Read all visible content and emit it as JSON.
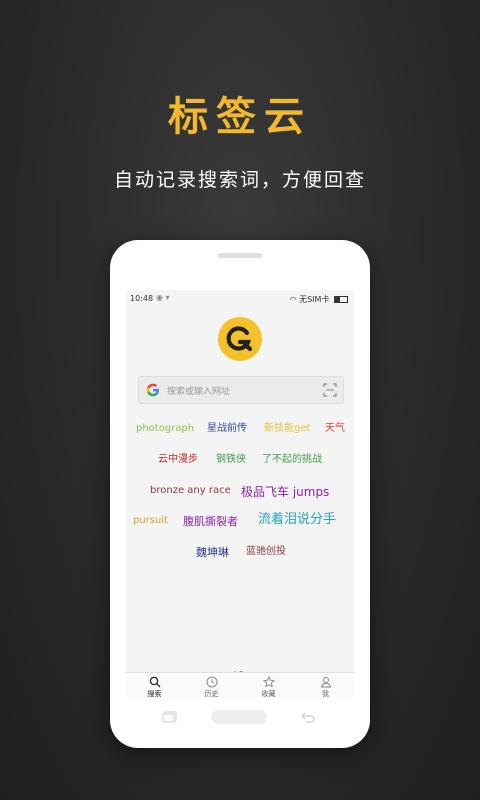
{
  "promo": {
    "title": "标签云",
    "subtitle": "自动记录搜索词，方便回查"
  },
  "status": {
    "time": "10:48",
    "carrier": "无SIM卡"
  },
  "search": {
    "placeholder": "搜索或输入网址"
  },
  "tags": [
    {
      "text": "photograph",
      "color": "#8bc34a"
    },
    {
      "text": "星战前传",
      "color": "#3949ab"
    },
    {
      "text": "新技能get",
      "color": "#e6c13c"
    },
    {
      "text": "天气",
      "color": "#e53935"
    },
    {
      "text": "云中漫步",
      "color": "#c62828"
    },
    {
      "text": "钢铁侠",
      "color": "#43a047"
    },
    {
      "text": "了不起的挑战",
      "color": "#43a047"
    },
    {
      "text": "bronze any race",
      "color": "#8d3b3b"
    },
    {
      "text": "极品飞车 jumps",
      "color": "#8e24aa"
    },
    {
      "text": "pursuit",
      "color": "#c9a227"
    },
    {
      "text": "腹肌撕裂者",
      "color": "#8e24aa"
    },
    {
      "text": "流着泪说分手",
      "color": "#26a6b0"
    },
    {
      "text": "魏坤琳",
      "color": "#283593"
    },
    {
      "text": "蓝驰创投",
      "color": "#8d3b3b"
    }
  ],
  "tabs": [
    {
      "label": "搜索"
    },
    {
      "label": "历史"
    },
    {
      "label": "收藏"
    },
    {
      "label": "我"
    }
  ],
  "colors": {
    "accent": "#f2b92c",
    "logo": "#f5c12b"
  }
}
